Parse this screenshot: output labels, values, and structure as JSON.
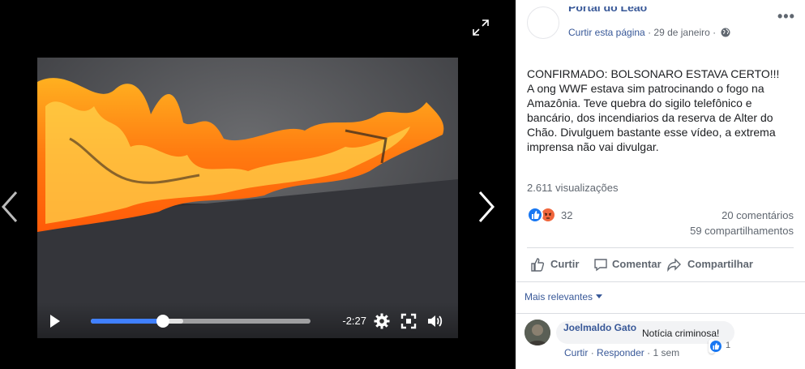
{
  "video": {
    "time_remaining": "-2:27",
    "progress_fraction": 0.33,
    "buffer_fraction": 0.42,
    "play_icon": "play-icon",
    "settings_icon": "gear-icon",
    "fullscreen_icon": "fullscreen-icon",
    "volume_icon": "volume-icon",
    "expand_icon": "expand-icon"
  },
  "post": {
    "page_name": "Portal do Leão",
    "like_page": "Curtir esta página",
    "separator": "·",
    "date": "29 de janeiro",
    "text_lines": [
      "CONFIRMADO: BOLSONARO ESTAVA CERTO!!!",
      "A ong WWF estava sim patrocinando o fogo na Amazônia. Teve quebra do sigilo telefônico e bancário, dos incendiarios da reserva de Alter do Chão. Divulguem bastante esse vídeo, a extrema imprensa não vai divulgar."
    ],
    "views": "2.611 visualizações",
    "reaction_count": "32",
    "comments": "20 comentários",
    "shares": "59 compartilhamentos"
  },
  "actions": {
    "like": "Curtir",
    "comment": "Comentar",
    "share": "Compartilhar"
  },
  "comments_section": {
    "sort_label": "Mais relevantes",
    "items": [
      {
        "author": "Joelmaldo Gato",
        "text": "Notícia criminosa!",
        "like": "Curtir",
        "reply": "Responder",
        "time": "1 sem",
        "likes": "1"
      }
    ]
  },
  "colors": {
    "facebook_blue": "#385898",
    "like_blue": "#1877f2",
    "angry_orange": "#f0663c"
  }
}
